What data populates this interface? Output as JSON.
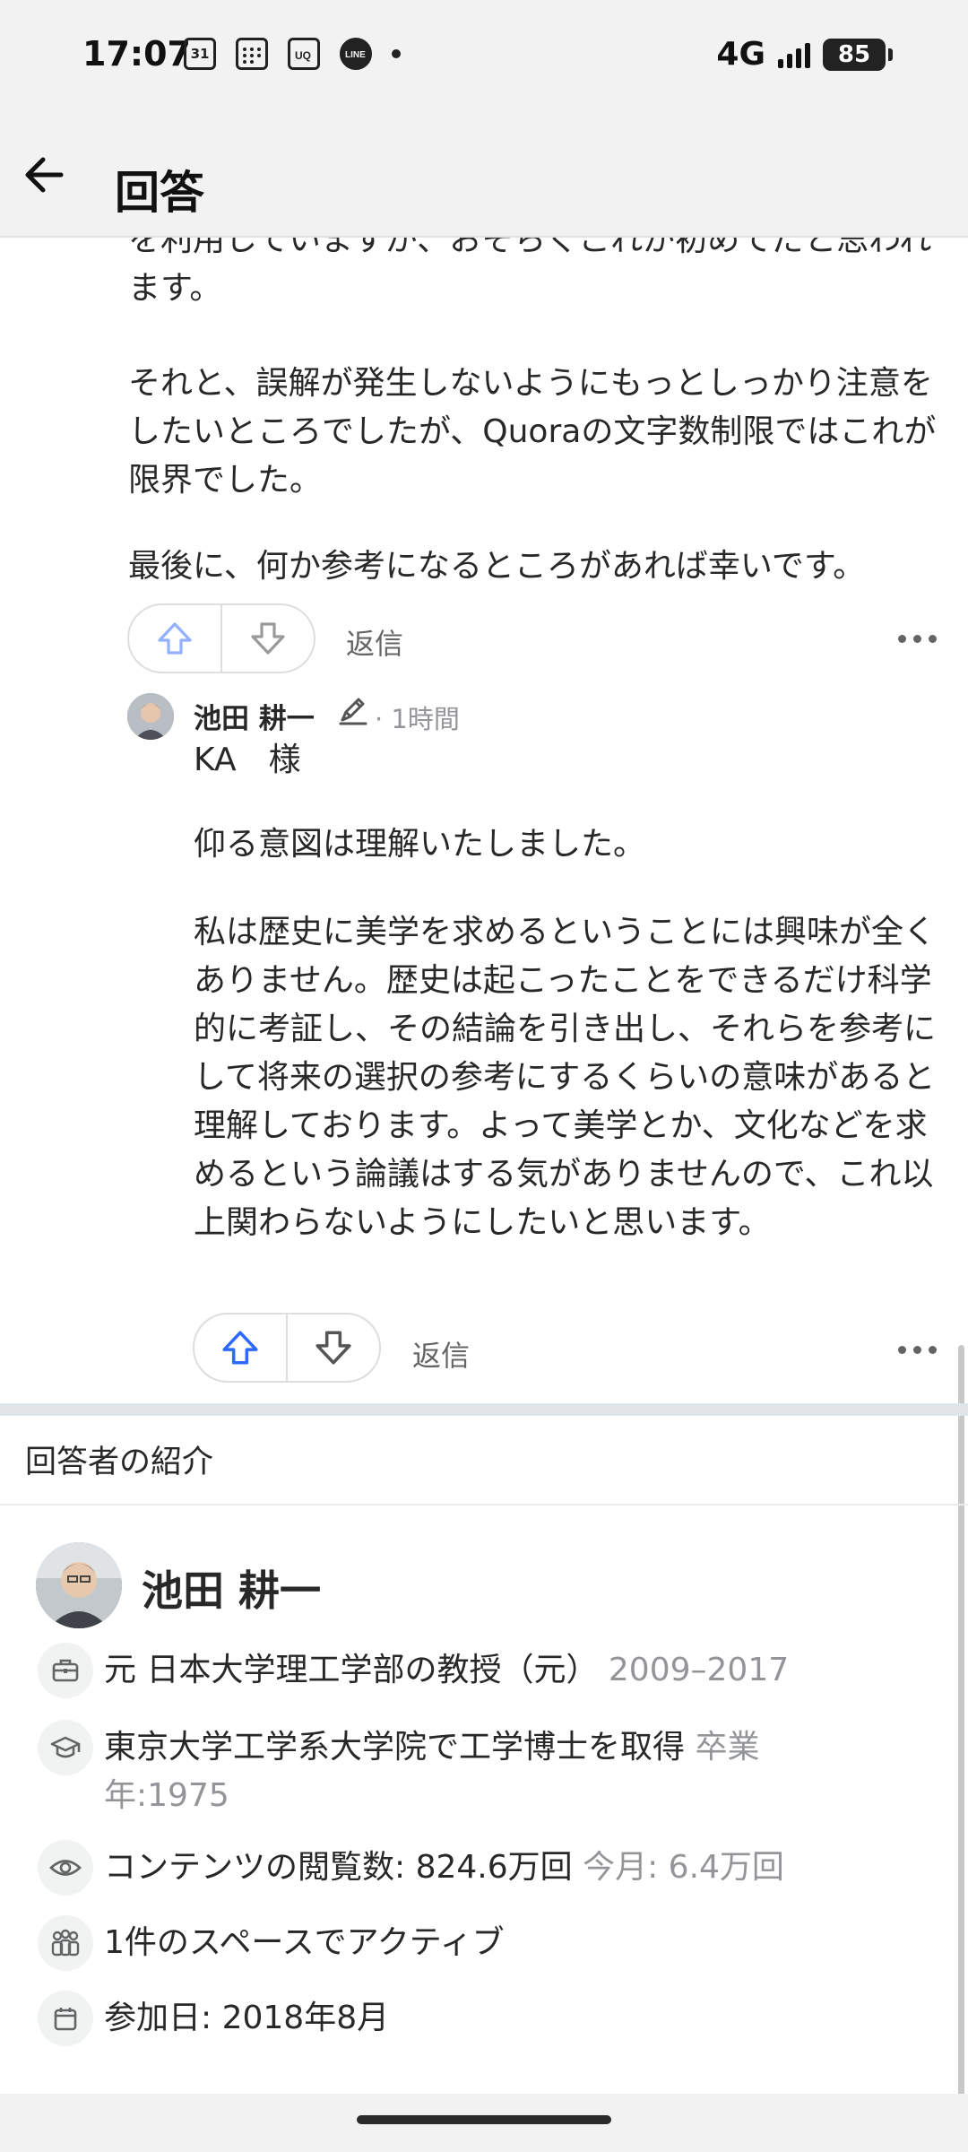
{
  "status_bar": {
    "time": "17:07",
    "notification_icons": [
      "calendar-31-icon",
      "calendar-grid-icon",
      "uq-app-icon",
      "line-app-icon"
    ],
    "calendar_day": "31",
    "network": "4G",
    "battery": "85"
  },
  "header": {
    "title": "回答"
  },
  "comment_thread": {
    "parent_paragraphs": [
      "を利用していますが、おそらくこれが初めてだと思われます。",
      "それと、誤解が発生しないようにもっとしっかり注意をしたいところでしたが、Quoraの文字数制限ではこれが限界でした。",
      "最後に、何か参考になるところがあれば幸いです。"
    ],
    "parent_reply_label": "返信",
    "reply": {
      "author": "池田 耕一",
      "time": "· 1時間",
      "paragraphs": [
        "KA　様",
        "仰る意図は理解いたしました。",
        "私は歴史に美学を求めるということには興味が全くありません。歴史は起こったことをできるだけ科学的に考証し、その結論を引き出し、それらを参考にして将来の選択の参考にするくらいの意味があると理解しております。よって美学とか、文化などを求めるという論議はする気がありませんので、これ以上関わらないようにしたいと思います。"
      ],
      "reply_label": "返信"
    }
  },
  "about_author": {
    "section_title": "回答者の紹介",
    "name": "池田 耕一",
    "credentials": [
      {
        "icon": "briefcase-icon",
        "text": "元 日本大学理工学部の教授（元）",
        "muted": "2009–2017"
      },
      {
        "icon": "graduation-cap-icon",
        "text": "東京大学工学系大学院で工学博士を取得",
        "muted": "卒業年:1975"
      },
      {
        "icon": "eye-icon",
        "text": "コンテンツの閲覧数: 824.6万回",
        "muted": "今月: 6.4万回"
      },
      {
        "icon": "people-icon",
        "text": "1件のスペースでアクティブ",
        "muted": ""
      },
      {
        "icon": "calendar-icon",
        "text": "参加日: 2018年8月",
        "muted": ""
      }
    ]
  },
  "colors": {
    "upvote_active": "#2e69ff",
    "upvote_faded": "#92b0ff",
    "text": "#282829",
    "muted": "#939598"
  }
}
